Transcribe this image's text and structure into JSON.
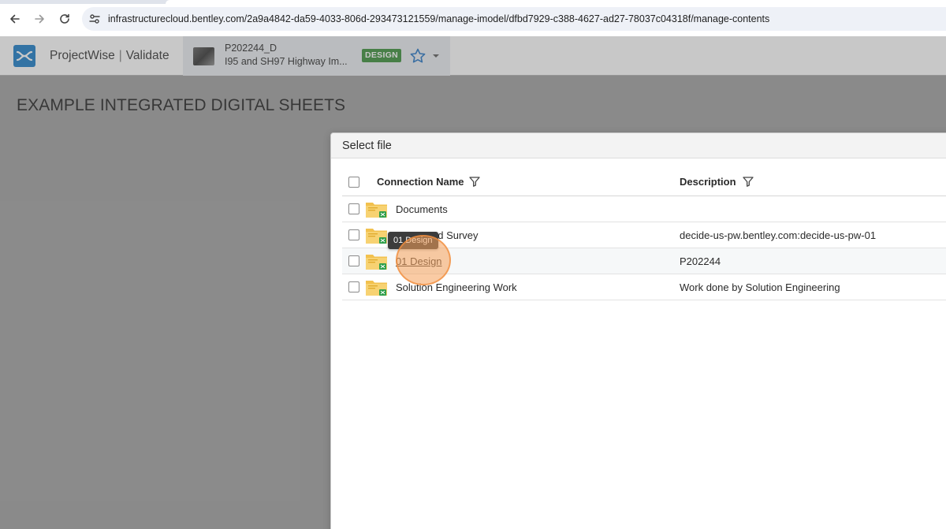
{
  "browser": {
    "url": "infrastructurecloud.bentley.com/2a9a4842-da59-4033-806d-293473121559/manage-imodel/dfbd7929-c388-4627-ad27-78037c04318f/manage-contents",
    "back_icon": "arrow-left-icon",
    "forward_icon": "arrow-right-icon",
    "reload_icon": "reload-icon",
    "site_info_icon": "tune-icon"
  },
  "header": {
    "app_name_left": "ProjectWise",
    "app_name_sep": "|",
    "app_name_right": "Validate",
    "project": {
      "code": "P202244_D",
      "title": "I95 and SH97 Highway Im...",
      "badge": "DESIGN",
      "badge_color": "#2f8a2f"
    },
    "accent": "#0f76c6"
  },
  "page": {
    "title": "EXAMPLE INTEGRATED DIGITAL SHEETS"
  },
  "modal": {
    "title": "Select file",
    "columns": {
      "name": "Connection Name",
      "description": "Description"
    },
    "rows": [
      {
        "name": "Documents",
        "description": ""
      },
      {
        "name": "Background Survey",
        "visible_name": "nd Survey",
        "description": "decide-us-pw.bentley.com:decide-us-pw-01"
      },
      {
        "name": "01 Design",
        "description": "P202244"
      },
      {
        "name": "Solution Engineering Work",
        "description": "Work done by Solution Engineering"
      }
    ],
    "tooltip": "01 Design"
  }
}
